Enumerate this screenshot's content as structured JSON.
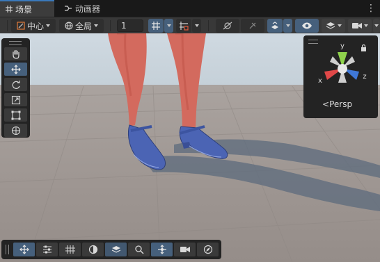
{
  "tabs": [
    {
      "label": "场景",
      "icon": "grid-icon",
      "active": true
    },
    {
      "label": "动画器",
      "icon": "animator-icon",
      "active": false
    }
  ],
  "toolbar": {
    "pivot_label": "中心",
    "space_label": "全局",
    "snap_increment": "1"
  },
  "overlay": {
    "gizmo": {
      "axis_y": "y",
      "axis_x": "x",
      "axis_z": "z",
      "projection_label": "Persp"
    }
  },
  "colors": {
    "accent": "#3a79bb",
    "selected_button": "#46607c",
    "axis_x": "#e04848",
    "axis_y": "#8fd24c",
    "axis_z": "#3f78d8"
  },
  "left_tools": [
    "hand-icon",
    "move-icon",
    "rotate-icon",
    "scale-icon",
    "rect-icon",
    "transform-icon"
  ],
  "bottom_tools": [
    "move-icon",
    "sliders-icon",
    "grid-snap-icon",
    "shading-icon",
    "layers-icon",
    "search-icon",
    "gizmo-icon",
    "camera-icon",
    "compass-icon"
  ]
}
